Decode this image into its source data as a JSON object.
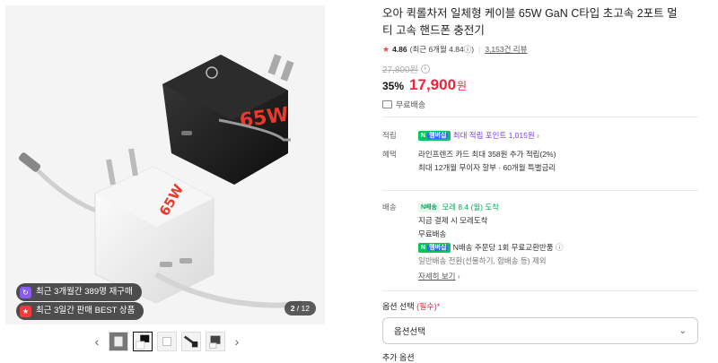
{
  "gallery": {
    "badges": [
      {
        "icon": "repurchase-icon",
        "text": "최근 3개월간 389명 재구매"
      },
      {
        "icon": "best-icon",
        "text": "최근 3일간 판매 BEST 상품"
      }
    ],
    "counter_current": "2",
    "counter_sep": " / ",
    "counter_total": "12",
    "prev_arrow": "‹",
    "next_arrow": "›"
  },
  "product": {
    "title": "오아 퀵롤차저 일체형 케이블 65W GaN C타입 초고속 2포트 멀티 고속 핸드폰 충전기",
    "rating_star": "★",
    "rating": "4.86",
    "rating_detail": "(최근 6개월 4.84",
    "rating_info_icon": "ⓘ",
    "rating_detail_close": ")",
    "reviews": "3,153건 리뷰",
    "original_price": "27,800원",
    "discount": "35%",
    "price": "17,900",
    "currency": "원",
    "shipping": "무료배송"
  },
  "benefits": {
    "points_label": "적립",
    "points_badge": "N",
    "points_badge_sub": "멤버십",
    "points_text": "최대 적립 포인트 1,015원",
    "points_chevron": "›",
    "benefit_label": "혜택",
    "benefit_lines": [
      "라인프렌즈 카드 최대 358원 추가 적립(2%)",
      "최대 12개월 무이자 할부 · 60개월 특별금리"
    ]
  },
  "delivery": {
    "label": "배송",
    "badge": "N배송",
    "arrival": "모레 8.4 (월) 도착",
    "line1": "지금 결제 시 모레도착",
    "line2": "무료배송",
    "return_badge": "N",
    "return_badge_sub": "멤버십",
    "return_text": "N배송 주문당 1회 무료교환반품",
    "return_info_icon": "ⓘ",
    "note": "일반배송 전환(선물하기, 합배송 등) 제외",
    "more_link": "자세히 보기",
    "more_chevron": "›"
  },
  "options": {
    "label": "옵션 선택",
    "required": "(필수)*",
    "select_value": "옵션선택",
    "add_label": "추가 옵션"
  },
  "colors": {
    "price_red": "#f4213a",
    "naver_green": "#03c75a",
    "point_purple": "#7b3cf2"
  }
}
